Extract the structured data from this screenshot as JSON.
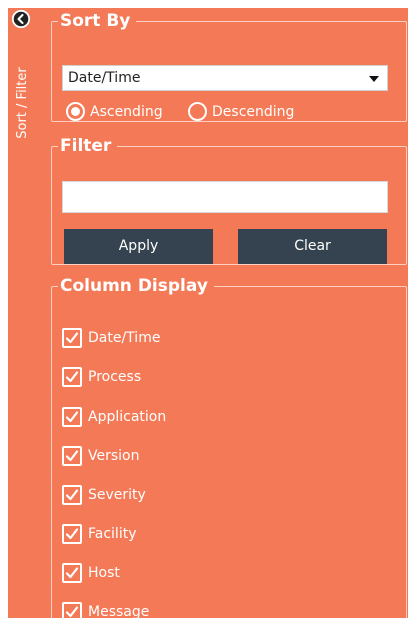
{
  "side_tab": {
    "label": "Sort / Filter",
    "collapse_icon": "chevron-left-icon"
  },
  "sort_by": {
    "title": "Sort By",
    "selected": "Date/Time",
    "order_options": [
      {
        "label": "Ascending",
        "checked": true
      },
      {
        "label": "Descending",
        "checked": false
      }
    ]
  },
  "filter": {
    "title": "Filter",
    "value": "",
    "apply_label": "Apply",
    "clear_label": "Clear"
  },
  "column_display": {
    "title": "Column Display",
    "columns": [
      {
        "label": "Date/Time",
        "checked": true
      },
      {
        "label": "Process",
        "checked": true
      },
      {
        "label": "Application",
        "checked": true
      },
      {
        "label": "Version",
        "checked": true
      },
      {
        "label": "Severity",
        "checked": true
      },
      {
        "label": "Facility",
        "checked": true
      },
      {
        "label": "Host",
        "checked": true
      },
      {
        "label": "Message",
        "checked": true
      }
    ]
  },
  "colors": {
    "panel": "#f47a57",
    "button": "#34434f",
    "border": "#fbd0c2",
    "text": "#ffffff"
  }
}
